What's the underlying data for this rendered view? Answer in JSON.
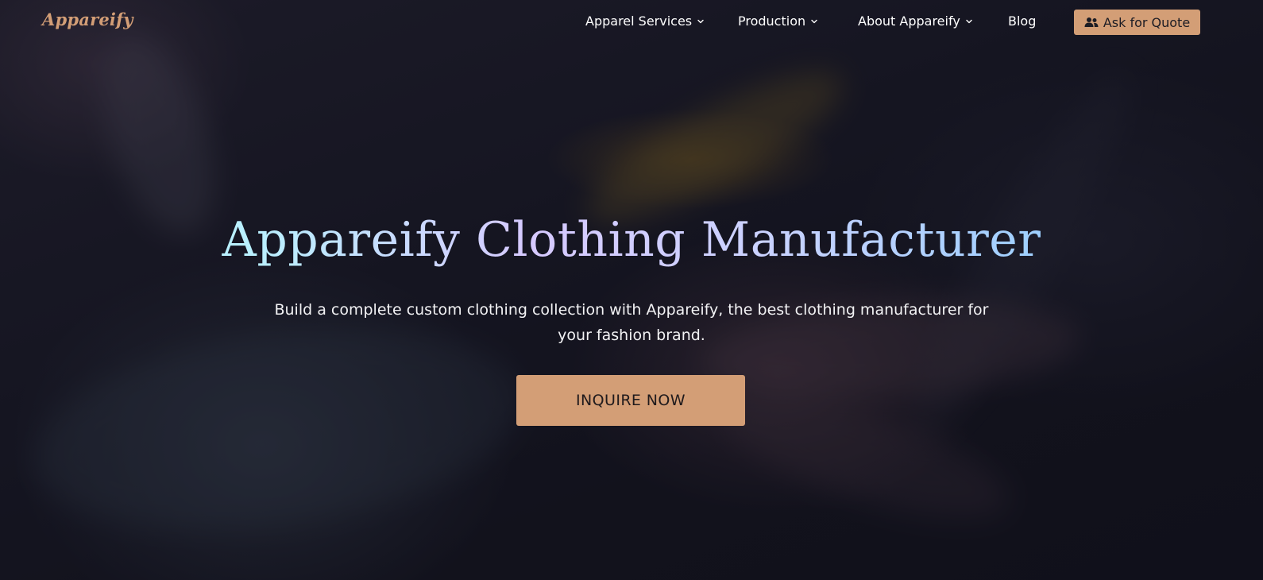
{
  "brand": {
    "logo_text": "Appareify",
    "accent_color": "#d39e76"
  },
  "nav": {
    "items": [
      {
        "label": "Apparel Services",
        "has_dropdown": true,
        "icon": "chevron-down-icon"
      },
      {
        "label": "Production",
        "has_dropdown": true,
        "icon": "chevron-down-icon"
      },
      {
        "label": "About Appareify",
        "has_dropdown": true,
        "icon": "chevron-down-icon"
      },
      {
        "label": "Blog",
        "has_dropdown": false
      }
    ],
    "cta": {
      "label": "Ask for Quote",
      "icon": "users-icon"
    }
  },
  "hero": {
    "title": "Appareify Clothing Manufacturer",
    "subtitle": "Build a complete custom clothing collection with Appareify, the best clothing manufacturer for your fashion brand.",
    "button_label": "INQUIRE NOW",
    "title_gradient": [
      "#b9f0ff",
      "#d6c9ff",
      "#9fd0ff"
    ],
    "background_color": "#14141f"
  }
}
